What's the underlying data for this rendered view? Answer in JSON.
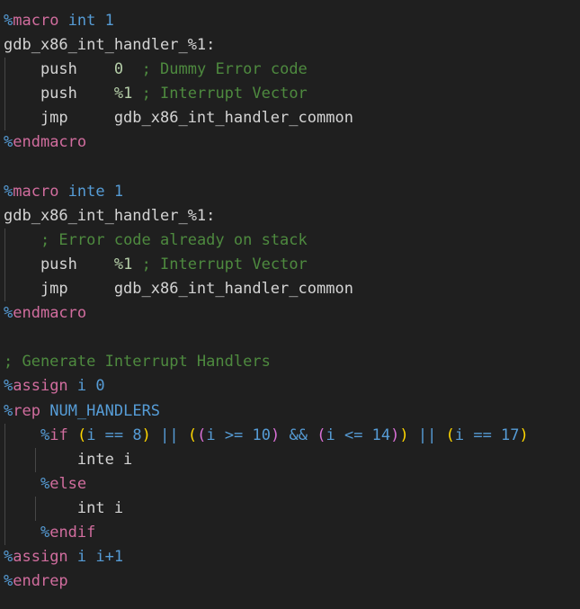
{
  "editor": {
    "language": "nasm-assembly",
    "theme": "dark-modern",
    "colors": {
      "background": "#1f1f1f",
      "foreground": "#d4d4d4",
      "comment": "#4e8a3f",
      "directive_keyword": "#d16d9e",
      "directive_sigil": "#569cd6",
      "identifier_blue": "#569cd6",
      "number": "#b5cea8",
      "bracket_level_1": "#ffd700",
      "bracket_level_2": "#da70d6",
      "indent_guide": "#474747"
    }
  },
  "code": {
    "lines": [
      {
        "indent_guides": 0,
        "tokens": [
          {
            "text": "%",
            "kind": "pct"
          },
          {
            "text": "macro",
            "kind": "dir"
          },
          {
            "text": " ",
            "kind": "plain"
          },
          {
            "text": "int 1",
            "kind": "blue"
          }
        ]
      },
      {
        "indent_guides": 0,
        "tokens": [
          {
            "text": "gdb_x86_int_handler_%1:",
            "kind": "plain"
          }
        ]
      },
      {
        "indent_guides": 1,
        "tokens": [
          {
            "text": "    push    ",
            "kind": "plain"
          },
          {
            "text": "0",
            "kind": "num"
          },
          {
            "text": "  ",
            "kind": "plain"
          },
          {
            "text": "; Dummy Error code",
            "kind": "comment"
          }
        ]
      },
      {
        "indent_guides": 1,
        "tokens": [
          {
            "text": "    push    ",
            "kind": "plain"
          },
          {
            "text": "%1",
            "kind": "num"
          },
          {
            "text": " ",
            "kind": "plain"
          },
          {
            "text": "; Interrupt Vector",
            "kind": "comment"
          }
        ]
      },
      {
        "indent_guides": 1,
        "tokens": [
          {
            "text": "    jmp     gdb_x86_int_handler_common",
            "kind": "plain"
          }
        ]
      },
      {
        "indent_guides": 0,
        "tokens": [
          {
            "text": "%",
            "kind": "pct"
          },
          {
            "text": "endmacro",
            "kind": "dir"
          }
        ]
      },
      {
        "indent_guides": 0,
        "tokens": []
      },
      {
        "indent_guides": 0,
        "tokens": [
          {
            "text": "%",
            "kind": "pct"
          },
          {
            "text": "macro",
            "kind": "dir"
          },
          {
            "text": " ",
            "kind": "plain"
          },
          {
            "text": "inte 1",
            "kind": "blue"
          }
        ]
      },
      {
        "indent_guides": 0,
        "tokens": [
          {
            "text": "gdb_x86_int_handler_%1:",
            "kind": "plain"
          }
        ]
      },
      {
        "indent_guides": 1,
        "tokens": [
          {
            "text": "    ",
            "kind": "plain"
          },
          {
            "text": "; Error code already on stack",
            "kind": "comment"
          }
        ]
      },
      {
        "indent_guides": 1,
        "tokens": [
          {
            "text": "    push    ",
            "kind": "plain"
          },
          {
            "text": "%1",
            "kind": "num"
          },
          {
            "text": " ",
            "kind": "plain"
          },
          {
            "text": "; Interrupt Vector",
            "kind": "comment"
          }
        ]
      },
      {
        "indent_guides": 1,
        "tokens": [
          {
            "text": "    jmp     gdb_x86_int_handler_common",
            "kind": "plain"
          }
        ]
      },
      {
        "indent_guides": 0,
        "tokens": [
          {
            "text": "%",
            "kind": "pct"
          },
          {
            "text": "endmacro",
            "kind": "dir"
          }
        ]
      },
      {
        "indent_guides": 0,
        "tokens": []
      },
      {
        "indent_guides": 0,
        "tokens": [
          {
            "text": "; Generate Interrupt Handlers",
            "kind": "comment"
          }
        ]
      },
      {
        "indent_guides": 0,
        "tokens": [
          {
            "text": "%",
            "kind": "pct"
          },
          {
            "text": "assign",
            "kind": "dir"
          },
          {
            "text": " ",
            "kind": "plain"
          },
          {
            "text": "i 0",
            "kind": "blue"
          }
        ]
      },
      {
        "indent_guides": 0,
        "tokens": [
          {
            "text": "%",
            "kind": "pct"
          },
          {
            "text": "rep",
            "kind": "dir"
          },
          {
            "text": " ",
            "kind": "plain"
          },
          {
            "text": "NUM_HANDLERS",
            "kind": "blue"
          }
        ]
      },
      {
        "indent_guides": 1,
        "tokens": [
          {
            "text": "    ",
            "kind": "plain"
          },
          {
            "text": "%",
            "kind": "pct"
          },
          {
            "text": "if",
            "kind": "dir"
          },
          {
            "text": " ",
            "kind": "plain"
          },
          {
            "text": "(",
            "kind": "br1"
          },
          {
            "text": "i == 8",
            "kind": "blue"
          },
          {
            "text": ")",
            "kind": "br1"
          },
          {
            "text": " ",
            "kind": "plain"
          },
          {
            "text": "||",
            "kind": "blue"
          },
          {
            "text": " ",
            "kind": "plain"
          },
          {
            "text": "(",
            "kind": "br1"
          },
          {
            "text": "(",
            "kind": "br2"
          },
          {
            "text": "i >= 10",
            "kind": "blue"
          },
          {
            "text": ")",
            "kind": "br2"
          },
          {
            "text": " ",
            "kind": "plain"
          },
          {
            "text": "&&",
            "kind": "blue"
          },
          {
            "text": " ",
            "kind": "plain"
          },
          {
            "text": "(",
            "kind": "br2"
          },
          {
            "text": "i <= 14",
            "kind": "blue"
          },
          {
            "text": ")",
            "kind": "br2"
          },
          {
            "text": ")",
            "kind": "br1"
          },
          {
            "text": " ",
            "kind": "plain"
          },
          {
            "text": "||",
            "kind": "blue"
          },
          {
            "text": " ",
            "kind": "plain"
          },
          {
            "text": "(",
            "kind": "br1"
          },
          {
            "text": "i == 17",
            "kind": "blue"
          },
          {
            "text": ")",
            "kind": "br1"
          }
        ]
      },
      {
        "indent_guides": 2,
        "tokens": [
          {
            "text": "        inte i",
            "kind": "plain"
          }
        ]
      },
      {
        "indent_guides": 1,
        "tokens": [
          {
            "text": "    ",
            "kind": "plain"
          },
          {
            "text": "%",
            "kind": "pct"
          },
          {
            "text": "else",
            "kind": "dir"
          }
        ]
      },
      {
        "indent_guides": 2,
        "tokens": [
          {
            "text": "        int i",
            "kind": "plain"
          }
        ]
      },
      {
        "indent_guides": 1,
        "tokens": [
          {
            "text": "    ",
            "kind": "plain"
          },
          {
            "text": "%",
            "kind": "pct"
          },
          {
            "text": "endif",
            "kind": "dir"
          }
        ]
      },
      {
        "indent_guides": 0,
        "tokens": [
          {
            "text": "%",
            "kind": "pct"
          },
          {
            "text": "assign",
            "kind": "dir"
          },
          {
            "text": " ",
            "kind": "plain"
          },
          {
            "text": "i i+1",
            "kind": "blue"
          }
        ]
      },
      {
        "indent_guides": 0,
        "tokens": [
          {
            "text": "%",
            "kind": "pct"
          },
          {
            "text": "endrep",
            "kind": "dir"
          }
        ]
      }
    ]
  }
}
